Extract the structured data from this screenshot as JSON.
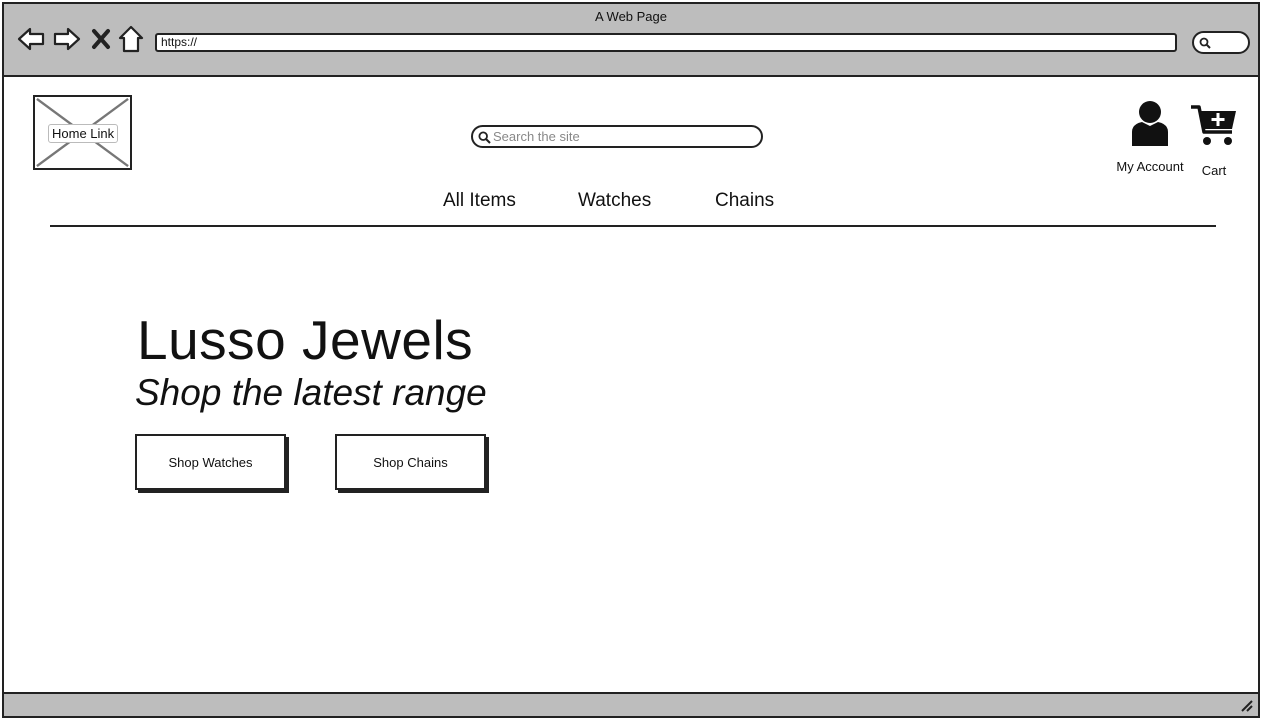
{
  "browser": {
    "window_title": "A Web Page",
    "url": "https://"
  },
  "header": {
    "logo_label": "Home Link",
    "search": {
      "placeholder": "Search the site",
      "value": ""
    },
    "account_label": "My Account",
    "cart_label": "Cart"
  },
  "nav": {
    "items": [
      {
        "label": "All Items"
      },
      {
        "label": "Watches"
      },
      {
        "label": "Chains"
      }
    ]
  },
  "hero": {
    "title": "Lusso Jewels",
    "subtitle": "Shop the latest range",
    "buttons": [
      {
        "label": "Shop Watches"
      },
      {
        "label": "Shop Chains"
      }
    ]
  },
  "icons": [
    "back-arrow-icon",
    "forward-arrow-icon",
    "close-icon",
    "home-icon",
    "search-icon",
    "user-icon",
    "cart-icon",
    "resize-grip-icon"
  ],
  "colors": {
    "chrome": "#bdbdbd",
    "ink": "#222222"
  }
}
